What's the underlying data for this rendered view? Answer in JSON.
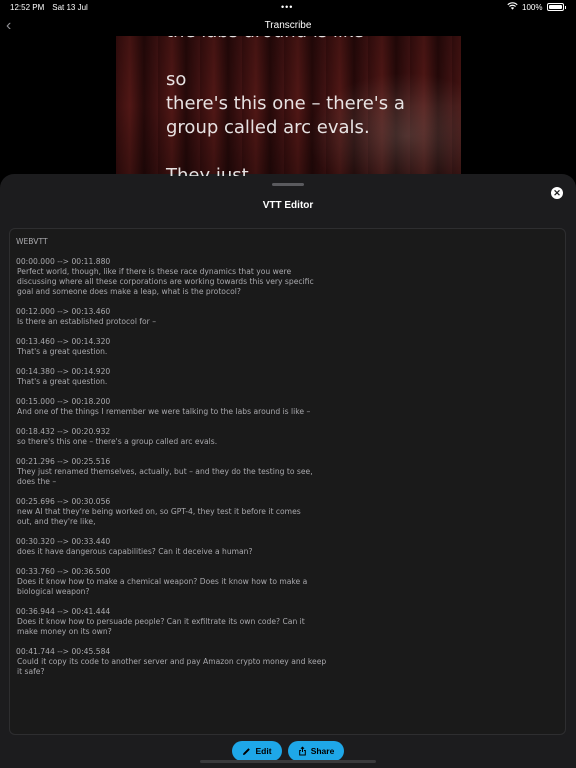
{
  "status_bar": {
    "time": "12:52 PM",
    "date": "Sat 13 Jul",
    "multitask_dots": "•••",
    "battery_percent": "100%",
    "icons": [
      "wifi-icon",
      "battery-icon"
    ]
  },
  "nav": {
    "back_icon": "chevron-left-icon",
    "back_glyph": "‹",
    "title": "Transcribe"
  },
  "video": {
    "caption_text": "the labs around is like\n\nso\nthere's this one – there's a\ngroup called arc evals.\n\nThey just"
  },
  "sheet": {
    "title": "VTT Editor",
    "close_icon": "close-icon",
    "close_glyph": "✕",
    "header": "WEBVTT",
    "cues": [
      {
        "time": "00:00.000 --> 00:11.880",
        "text": "Perfect world, though, like if there is these race dynamics that you were\ndiscussing where all these corporations are working towards this very specific\ngoal and someone does make a leap, what is the protocol?"
      },
      {
        "time": "00:12.000 --> 00:13.460",
        "text": "Is there an established protocol for –"
      },
      {
        "time": "00:13.460 --> 00:14.320",
        "text": "That's a great question."
      },
      {
        "time": "00:14.380 --> 00:14.920",
        "text": "That's a great question."
      },
      {
        "time": "00:15.000 --> 00:18.200",
        "text": "And one of the things I remember we were talking to the labs around is like –"
      },
      {
        "time": "00:18.432 --> 00:20.932",
        "text": "so there's this one – there's a group called arc evals."
      },
      {
        "time": "00:21.296 --> 00:25.516",
        "text": "They just renamed themselves, actually, but – and they do the testing to see,\ndoes the –"
      },
      {
        "time": "00:25.696 --> 00:30.056",
        "text": "new AI that they're being worked on, so GPT-4, they test it before it comes\nout, and they're like,"
      },
      {
        "time": "00:30.320 --> 00:33.440",
        "text": "does it have dangerous capabilities? Can it deceive a human?"
      },
      {
        "time": "00:33.760 --> 00:36.500",
        "text": "Does it know how to make a chemical weapon? Does it know how to make a\nbiological weapon?"
      },
      {
        "time": "00:36.944 --> 00:41.444",
        "text": "Does it know how to persuade people? Can it exfiltrate its own code? Can it\nmake money on its own?"
      },
      {
        "time": "00:41.744 --> 00:45.584",
        "text": "Could it copy its code to another server and pay Amazon crypto money and keep\nit safe?"
      }
    ]
  },
  "actions": {
    "edit_label": "Edit",
    "edit_icon": "pencil-icon",
    "share_label": "Share",
    "share_icon": "share-icon",
    "accent_color": "#1ea7e8"
  }
}
